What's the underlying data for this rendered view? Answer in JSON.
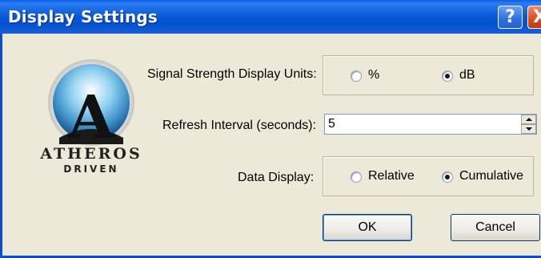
{
  "window": {
    "title": "Display Settings"
  },
  "titlebar_buttons": {
    "help": "?",
    "close": "X"
  },
  "logo": {
    "line1": "ATHEROS",
    "line2": "DRIVEN",
    "letter": "A"
  },
  "signal": {
    "label": "Signal Strength Display Units:",
    "options": [
      {
        "label": "%",
        "selected": false
      },
      {
        "label": "dB",
        "selected": true
      }
    ]
  },
  "refresh": {
    "label": "Refresh Interval (seconds):",
    "value": "5"
  },
  "data_display": {
    "label": "Data Display:",
    "options": [
      {
        "label": "Relative",
        "selected": false
      },
      {
        "label": "Cumulative",
        "selected": true
      }
    ]
  },
  "buttons": {
    "ok": "OK",
    "cancel": "Cancel"
  }
}
